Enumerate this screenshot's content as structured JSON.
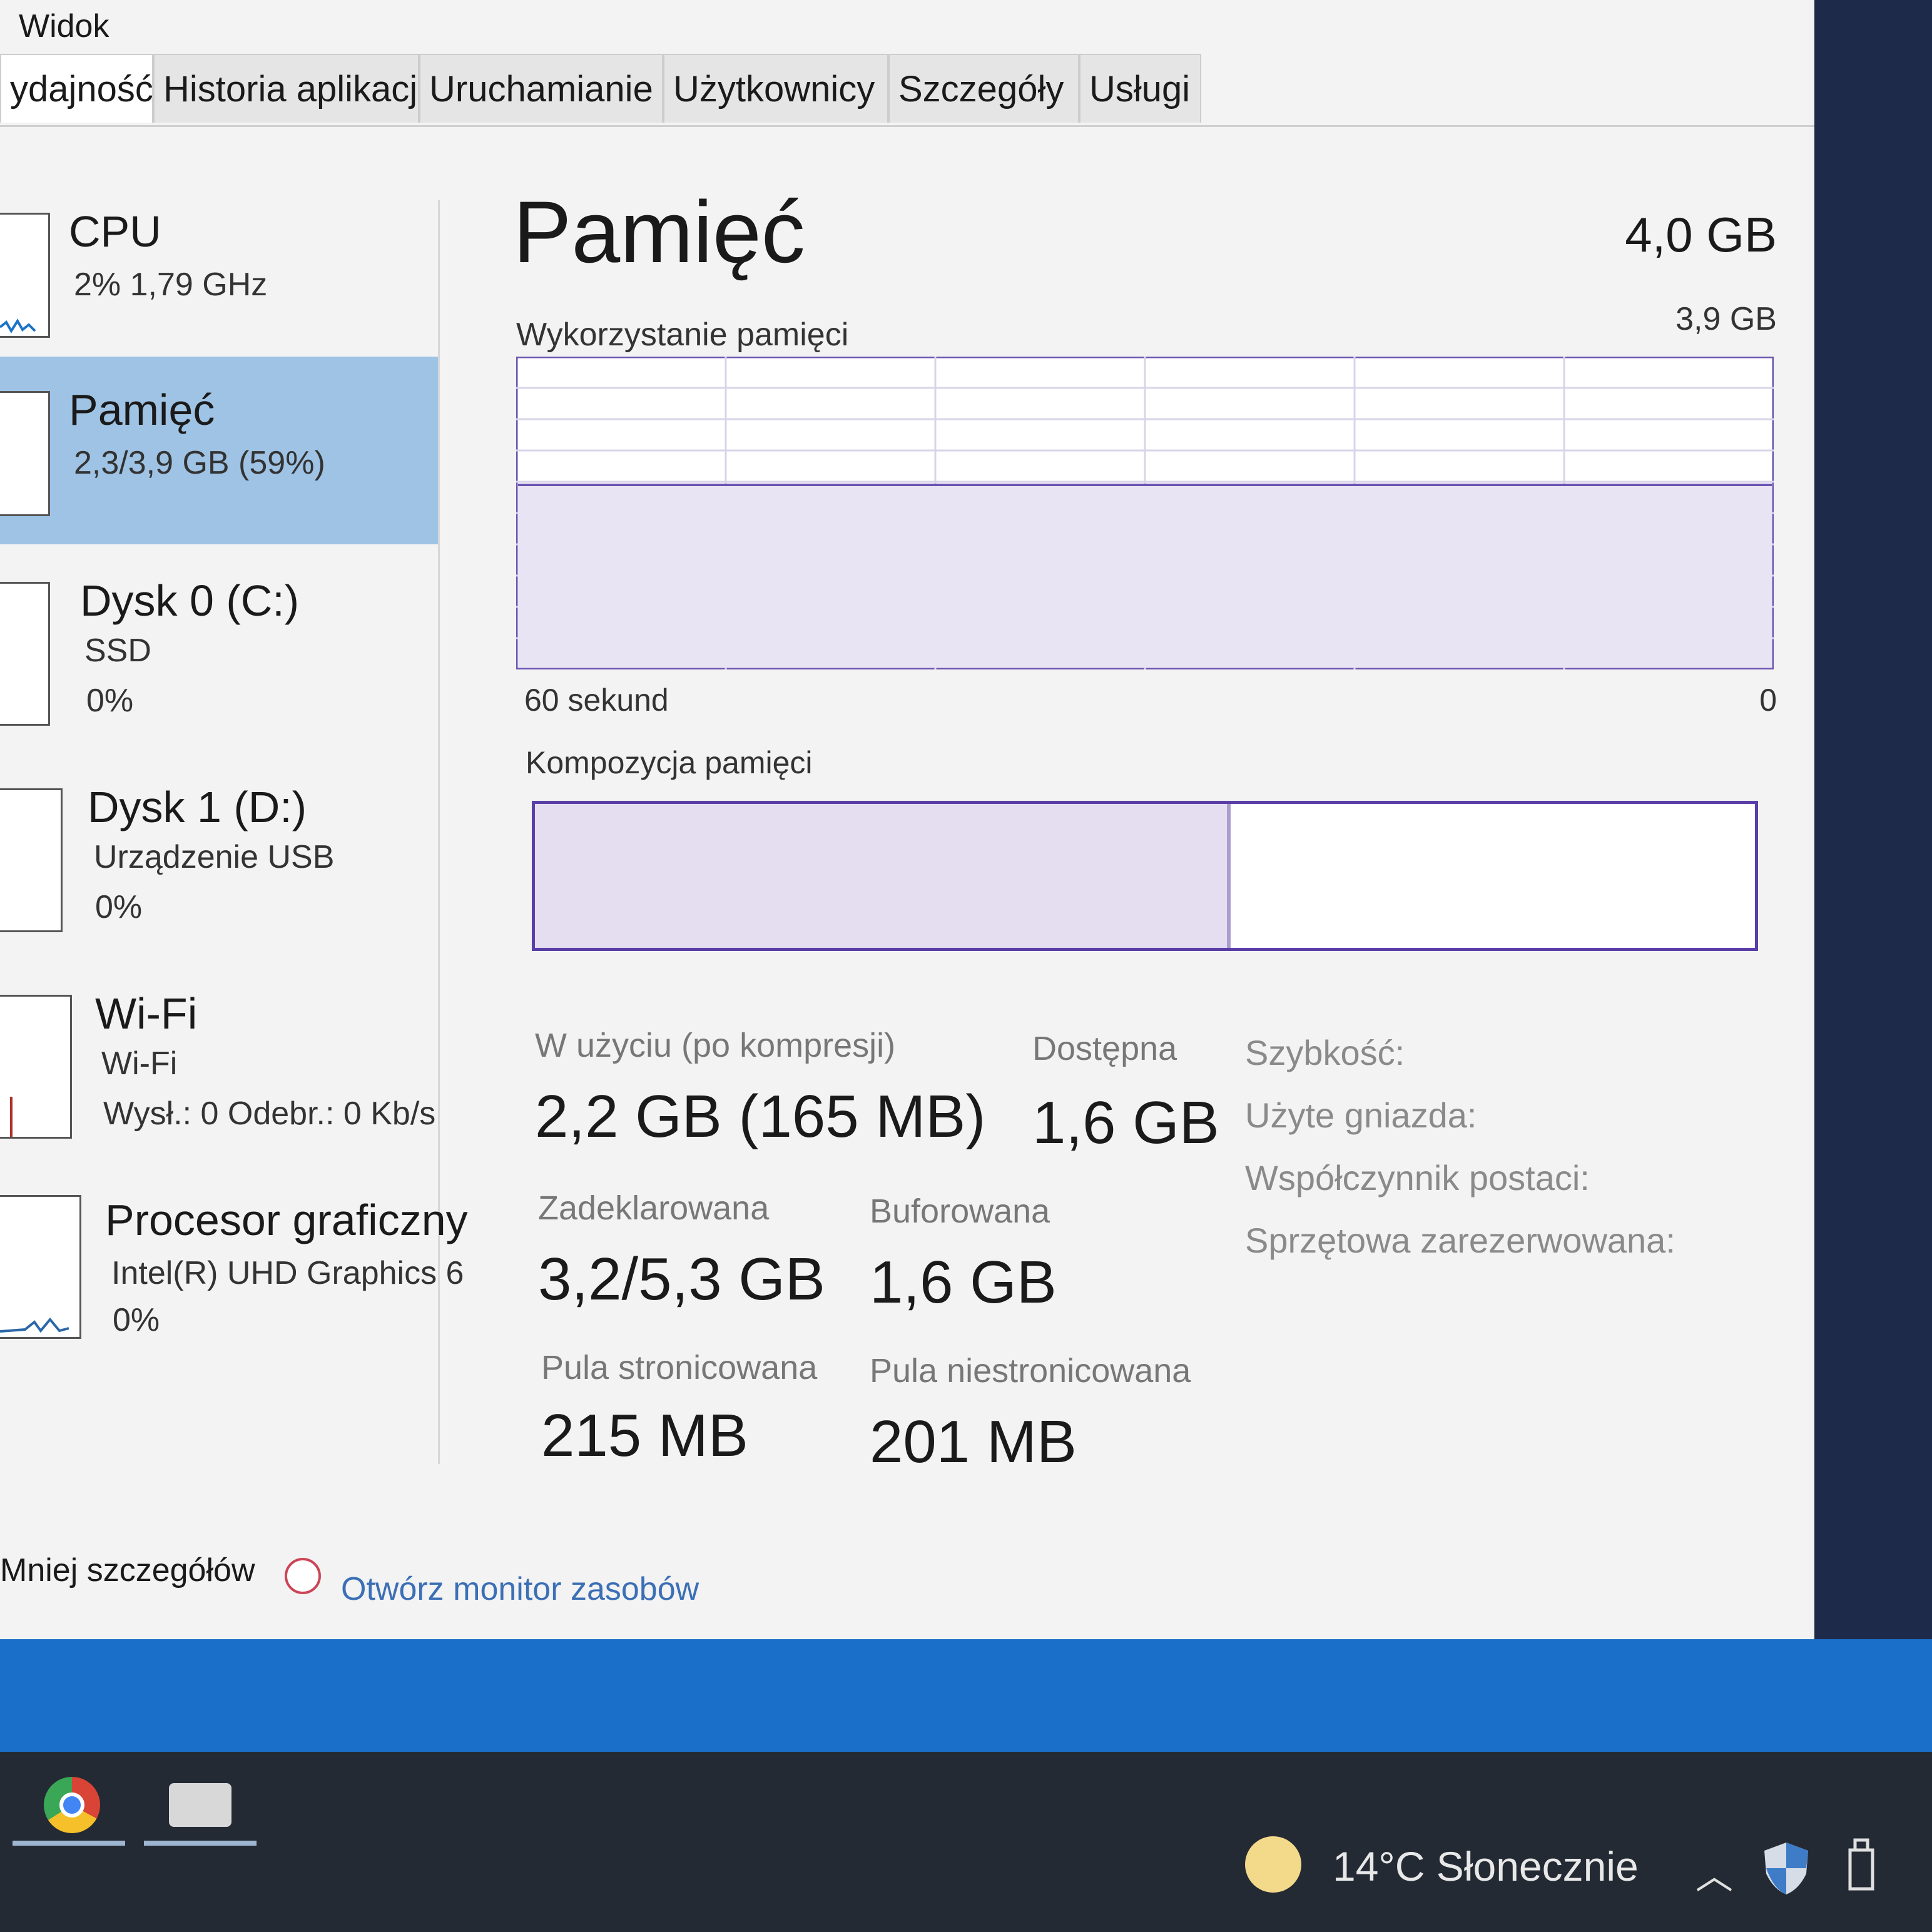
{
  "menu": {
    "view": "Widok"
  },
  "tabs": [
    "ydajność",
    "Historia aplikacji",
    "Uruchamianie",
    "Użytkownicy",
    "Szczegóły",
    "Usługi"
  ],
  "sidebar": {
    "items": [
      {
        "title": "CPU",
        "line1": "2%  1,79 GHz",
        "line2": ""
      },
      {
        "title": "Pamięć",
        "line1": "2,3/3,9 GB (59%)",
        "line2": ""
      },
      {
        "title": "Dysk 0 (C:)",
        "line1": "SSD",
        "line2": "0%"
      },
      {
        "title": "Dysk 1 (D:)",
        "line1": "Urządzenie USB",
        "line2": "0%"
      },
      {
        "title": "Wi-Fi",
        "line1": "Wi-Fi",
        "line2": "Wysł.: 0  Odebr.: 0 Kb/s"
      },
      {
        "title": "Procesor graficzny",
        "line1": "Intel(R) UHD Graphics 6",
        "line2": "0%"
      }
    ]
  },
  "main": {
    "title": "Pamięć",
    "total": "4,0 GB",
    "graph_label": "Wykorzystanie pamięci",
    "graph_max": "3,9 GB",
    "x_left": "60 sekund",
    "x_right": "0",
    "composition_label": "Kompozycja pamięci",
    "composition_used_fraction": 0.57,
    "usage_fraction": 0.59,
    "stats": {
      "in_use_label": "W użyciu (po kompresji)",
      "in_use_value": "2,2 GB (165 MB)",
      "available_label": "Dostępna",
      "available_value": "1,6 GB",
      "committed_label": "Zadeklarowana",
      "committed_value": "3,2/5,3 GB",
      "cached_label": "Buforowana",
      "cached_value": "1,6 GB",
      "paged_label": "Pula stronicowana",
      "paged_value": "215 MB",
      "nonpaged_label": "Pula niestronicowana",
      "nonpaged_value": "201 MB"
    },
    "right": {
      "speed_label": "Szybkość:",
      "slots_label": "Użyte gniazda:",
      "form_label": "Współczynnik postaci:",
      "reserved_label": "Sprzętowa zarezerwowana:"
    }
  },
  "footer": {
    "fewer_details": "Mniej szczegółów",
    "open_monitor": "Otwórz monitor zasobów"
  },
  "taskbar": {
    "weather": "14°C  Słonecznie"
  },
  "colors": {
    "accent": "#5b3fa8",
    "selected": "#9fc3e4",
    "graph_fill": "#e9e4f3"
  }
}
